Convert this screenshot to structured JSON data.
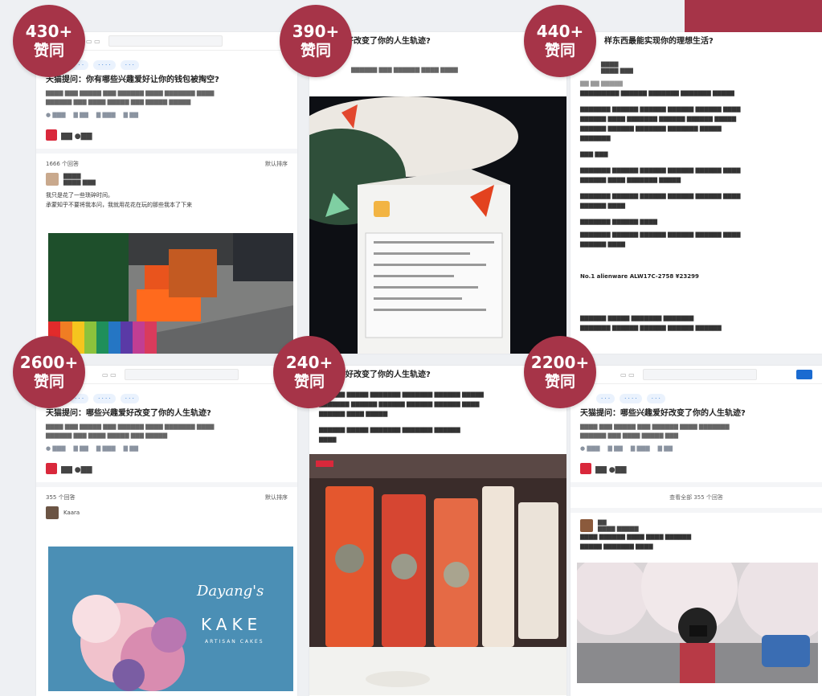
{
  "colors": {
    "badge": "#a63448",
    "link_blue": "#1a6bd1",
    "brand_red": "#d9283b"
  },
  "badges": [
    {
      "count": "430+",
      "label": "赞同"
    },
    {
      "count": "390+",
      "label": "赞同"
    },
    {
      "count": "440+",
      "label": "赞同"
    },
    {
      "count": "2600+",
      "label": "赞同"
    },
    {
      "count": "240+",
      "label": "赞同"
    },
    {
      "count": "2200+",
      "label": "赞同"
    }
  ],
  "panels": {
    "p1": {
      "question": "天猫提问：你有哪些兴趣爱好让你的钱包被掏空?",
      "answers_count": "1666 个回答",
      "sort_label": "默认排序",
      "line1": "我只是花了一些琐碎时间。",
      "line2": "承蒙知乎不要将我本问，我就用花花在玩的那些我本了下来"
    },
    "p2": {
      "question_tail": "好改变了你的人生轨迹?"
    },
    "p3": {
      "question_tail": "样东西最能实现你的理想生活?",
      "product": "No.1 alienware ALW17C-2758 ¥23299"
    },
    "p4": {
      "question": "天猫提问：哪些兴趣爱好改变了你的人生轨迹?",
      "answers_count": "355 个回答",
      "sort_label": "默认排序",
      "author": "Kaara",
      "image_brand": "Dayang's",
      "image_sub": "KAKE",
      "image_small": "ARTISAN CAKES"
    },
    "p5": {
      "question_tail": "好改变了你的人生轨迹?"
    },
    "p6": {
      "question": "天猫提问：哪些兴趣爱好改变了你的人生轨迹?",
      "view_all": "查看全部 355 个回答"
    }
  }
}
